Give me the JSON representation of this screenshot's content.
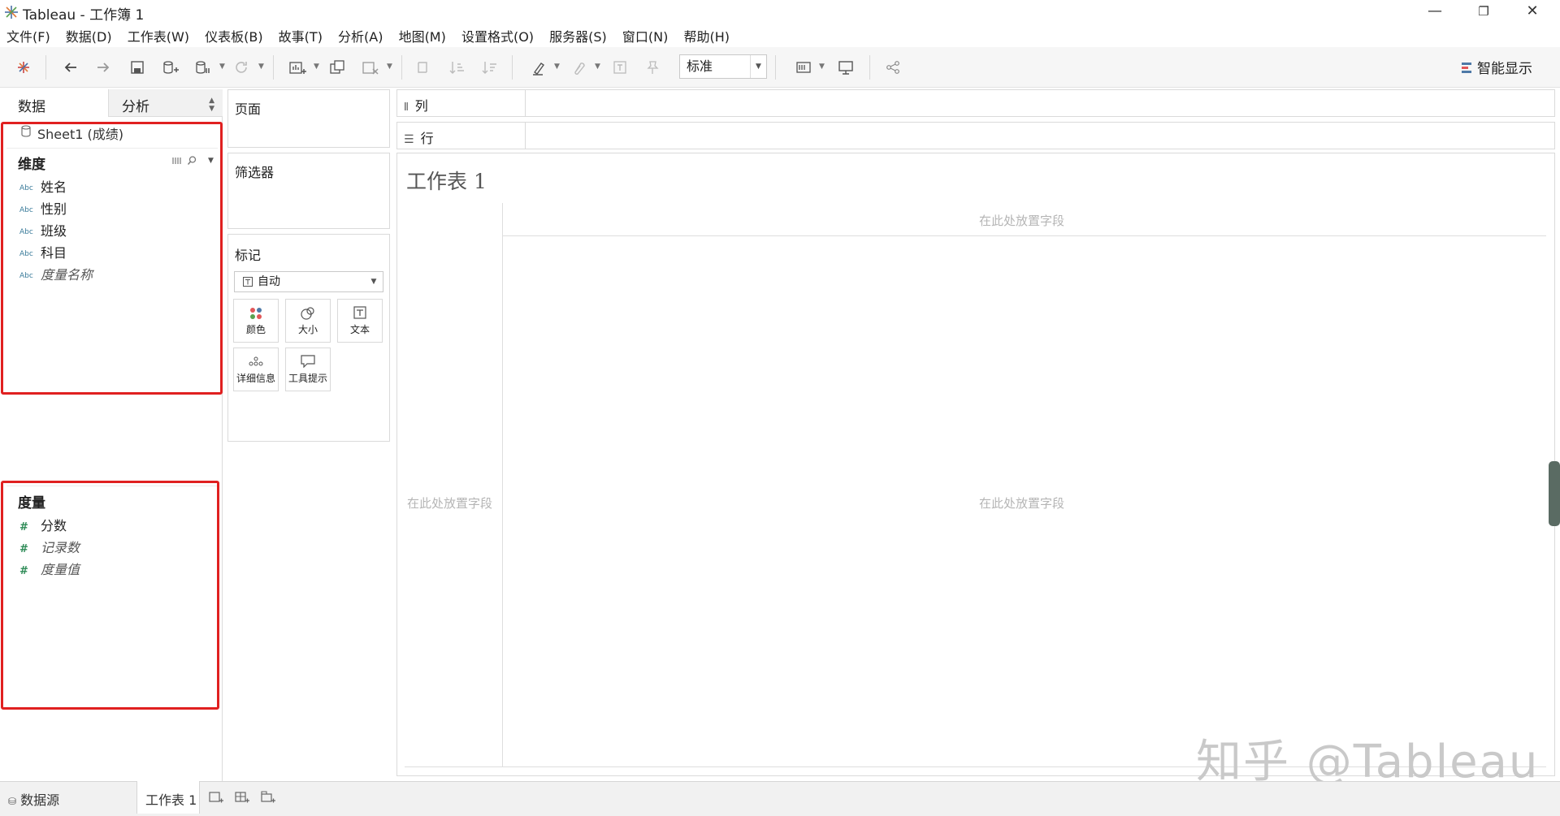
{
  "window": {
    "title": "Tableau - 工作簿 1",
    "controls": {
      "minimize": "—",
      "restore": "❐",
      "close": "✕"
    }
  },
  "menu": [
    "文件(F)",
    "数据(D)",
    "工作表(W)",
    "仪表板(B)",
    "故事(T)",
    "分析(A)",
    "地图(M)",
    "设置格式(O)",
    "服务器(S)",
    "窗口(N)",
    "帮助(H)"
  ],
  "toolbar": {
    "fit_value": "标准",
    "show_me_label": "智能显示"
  },
  "left_pane": {
    "tabs": {
      "data": "数据",
      "analysis": "分析"
    },
    "datasource": "Sheet1 (成绩)",
    "dimensions": {
      "title": "维度",
      "type_label": "Abc",
      "items": [
        {
          "label": "姓名",
          "italic": false
        },
        {
          "label": "性别",
          "italic": false
        },
        {
          "label": "班级",
          "italic": false
        },
        {
          "label": "科目",
          "italic": false
        },
        {
          "label": "度量名称",
          "italic": true
        }
      ]
    },
    "measures": {
      "title": "度量",
      "type_label": "#",
      "items": [
        {
          "label": "分数",
          "italic": false
        },
        {
          "label": "记录数",
          "italic": true
        },
        {
          "label": "度量值",
          "italic": true
        }
      ]
    }
  },
  "cards": {
    "pages": "页面",
    "filters": "筛选器",
    "marks": {
      "title": "标记",
      "type_value": "自动",
      "buttons": [
        "颜色",
        "大小",
        "文本",
        "详细信息",
        "工具提示"
      ]
    }
  },
  "shelves": {
    "columns": "列",
    "rows": "行"
  },
  "sheet": {
    "title": "工作表 1",
    "drop_hint": "在此处放置字段"
  },
  "bottom": {
    "datasource_tab": "数据源",
    "sheet_tab": "工作表 1"
  },
  "watermark": "知乎 @Tableau",
  "colors": {
    "highlight_box": "#e02020",
    "measure_icon": "#2e8b57",
    "dimension_icon": "#3a7b9a"
  }
}
